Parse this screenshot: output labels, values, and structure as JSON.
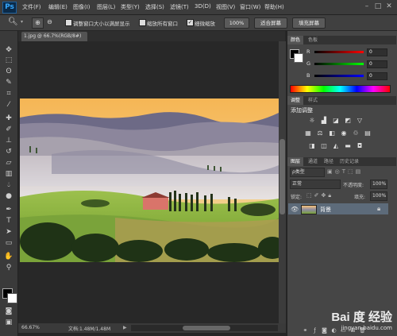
{
  "app": {
    "logo": "Ps"
  },
  "menu": [
    "文件(F)",
    "编辑(E)",
    "图像(I)",
    "图层(L)",
    "类型(Y)",
    "选择(S)",
    "滤镜(T)",
    "3D(D)",
    "视图(V)",
    "窗口(W)",
    "帮助(H)"
  ],
  "window_controls": [
    "–",
    "□",
    "✕"
  ],
  "options": {
    "resize_windows": "调整窗口大小以满屏显示",
    "zoom_all": "缩放所有窗口",
    "scrubby_zoom": "细微缩放",
    "scrubby_checked": true,
    "btn_100": "100%",
    "btn_fit": "适合屏幕",
    "btn_fill": "填充屏幕"
  },
  "document": {
    "tab": "1.jpg @ 66.7%(RGB/8#)",
    "close": "×",
    "zoom": "66.67%",
    "doc_size": "文档:1.48M/1.48M"
  },
  "tools": [
    "move-icon",
    "marquee-icon",
    "lasso-icon",
    "quick-select-icon",
    "crop-icon",
    "eyedropper-icon",
    "healing-icon",
    "brush-icon",
    "stamp-icon",
    "history-brush-icon",
    "eraser-icon",
    "gradient-icon",
    "blur-icon",
    "dodge-icon",
    "pen-icon",
    "type-icon",
    "path-select-icon",
    "shape-icon",
    "hand-icon",
    "zoom-icon"
  ],
  "color_panel": {
    "tabs": [
      "颜色",
      "色板"
    ],
    "channels": [
      {
        "label": "R",
        "value": "0"
      },
      {
        "label": "G",
        "value": "0"
      },
      {
        "label": "B",
        "value": "0"
      }
    ]
  },
  "adjust_panel": {
    "tabs": [
      "调整",
      "样式"
    ],
    "title": "添加调整"
  },
  "layers_panel": {
    "tabs": [
      "图层",
      "通道",
      "路径",
      "历史记录"
    ],
    "kind": "ρ类型",
    "blend": "正常",
    "opacity_label": "不透明度:",
    "opacity": "100%",
    "lock_label": "锁定:",
    "fill_label": "填充:",
    "fill": "100%",
    "layer_name": "背景"
  },
  "watermark": {
    "brand": "Bai 度 经验",
    "url": "jingyan.baidu.com"
  },
  "colors": {
    "accent": "#36a8ff",
    "panel": "#464646",
    "bg": "#262626"
  }
}
